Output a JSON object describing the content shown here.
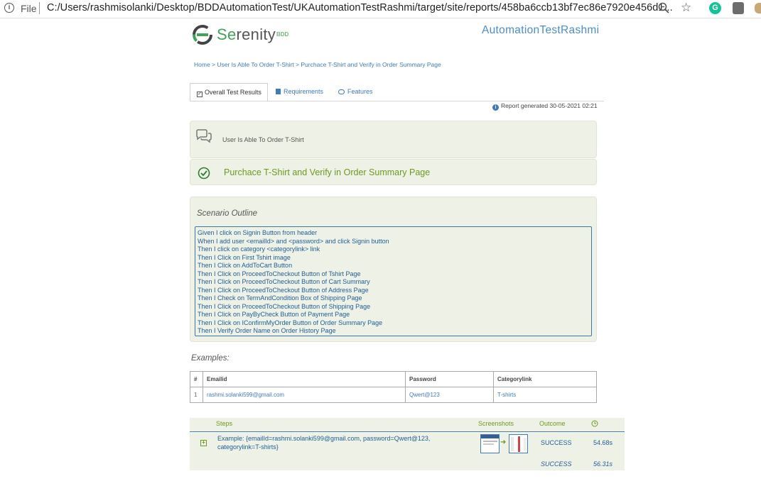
{
  "browser": {
    "file_label": "File",
    "url": "C:/Users/rashmisolanki/Desktop/BDDAutomationTest/UKAutomationTestRashmi/target/site/reports/458ba6ccb13bf7ec86e7920e456d1..."
  },
  "header": {
    "logo_brand_se": "Se",
    "logo_brand_rest": "renity",
    "logo_bdd": "BDD",
    "project_name": "AutomationTestRashmi"
  },
  "breadcrumb": "Home > User Is Able To Order T-Shirt > Purchace T-Shirt and Verify in Order Summary Page",
  "tabs": {
    "overall": "Overall Test Results",
    "requirements": "Requirements",
    "features": "Features"
  },
  "report_generated": "Report generated 30-05-2021 02:21",
  "story_title": "User Is Able To Order T-Shirt",
  "scenario_title": "Purchace T-Shirt and Verify in Order Summary Page",
  "scenario_outline_label": "Scenario Outline",
  "outline_steps": [
    "Given I click on Signin Button from header",
    "When I add user <emailId> and <password> and click Signin button",
    "Then I click on category <categorylink> link",
    "Then I Click on First Tshirt image",
    "Then I Click on AddToCart Button",
    "Then I Click on ProceedToCheckout Button of Tshirt Page",
    "Then I Click on ProceedToCheckout Button of Cart Summary",
    "Then I Click on ProceedToCheckout Button of Address Page",
    "Then I Check on TermAndCondition Box of Shipping Page",
    "Then I Click on ProceedToCheckout Button of Shipping Page",
    "Then I Click on PayByCheck Button of Payment Page",
    "Then I Click on IConfirmMyOrder Button of Order Summary Page",
    "Then I Verify Order Name on Order History Page"
  ],
  "examples": {
    "label": "Examples:",
    "headers": [
      "#",
      "Emailid",
      "Password",
      "Categorylink"
    ],
    "rows": [
      [
        "1",
        "rashmi.solanki599@gmail.com",
        "Qwert@123",
        "T-shirts"
      ]
    ]
  },
  "results": {
    "headers": {
      "steps": "Steps",
      "screenshots": "Screenshots",
      "outcome": "Outcome"
    },
    "example_text": "Example: {emailId=rashmi.solanki599@gmail.com, password=Qwert@123, categorylink=T-shirts}",
    "example_outcome": "SUCCESS",
    "example_duration": "54.68s",
    "total_outcome": "SUCCESS",
    "total_duration": "56.31s"
  },
  "colors": {
    "accent_blue": "#3d7cb8",
    "success_green": "#6c9a1f",
    "panel_bg": "#eef2e6",
    "brand_green": "#41a358"
  }
}
